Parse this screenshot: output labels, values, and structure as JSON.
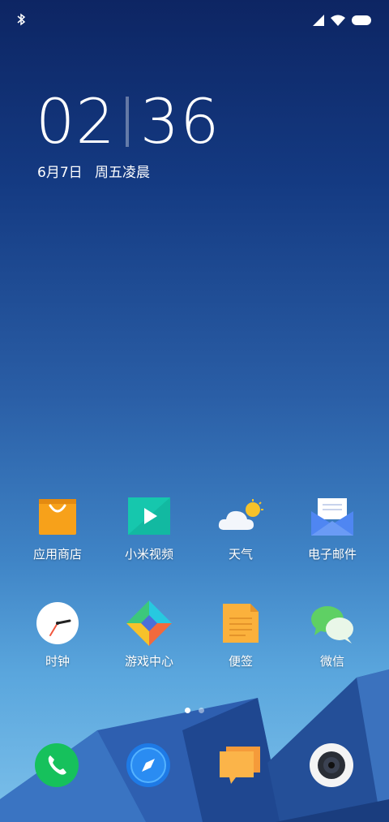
{
  "status_bar": {
    "bluetooth_icon": "bluetooth-icon",
    "signal_icon": "cell-signal-icon",
    "wifi_icon": "wifi-icon",
    "battery_icon": "battery-icon"
  },
  "clock": {
    "hours": "02",
    "minutes": "36"
  },
  "date": {
    "day": "6月7日",
    "weekday": "周五凌晨"
  },
  "apps_row1": [
    {
      "label": "应用商店",
      "icon": "shopping-bag-icon"
    },
    {
      "label": "小米视频",
      "icon": "play-icon"
    },
    {
      "label": "天气",
      "icon": "weather-icon"
    },
    {
      "label": "电子邮件",
      "icon": "mail-icon"
    }
  ],
  "apps_row2": [
    {
      "label": "时钟",
      "icon": "clock-icon"
    },
    {
      "label": "游戏中心",
      "icon": "game-center-icon"
    },
    {
      "label": "便签",
      "icon": "notes-icon"
    },
    {
      "label": "微信",
      "icon": "wechat-icon"
    }
  ],
  "page_indicator": {
    "pages": 2,
    "active": 1
  },
  "dock": [
    {
      "icon": "phone-icon"
    },
    {
      "icon": "browser-compass-icon"
    },
    {
      "icon": "messages-icon"
    },
    {
      "icon": "camera-icon"
    }
  ],
  "colors": {
    "accent": "#ffffff",
    "wall_top": "#0d2563",
    "wall_bottom": "#7cc0ea"
  }
}
